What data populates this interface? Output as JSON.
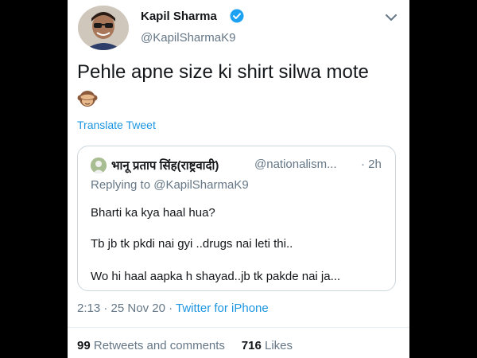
{
  "tweet": {
    "author_name": "Kapil Sharma",
    "author_handle": "@KapilSharmaK9",
    "text": "Pehle apne size ki shirt silwa mote",
    "emoji": "see-no-evil-monkey-icon",
    "translate_label": "Translate Tweet",
    "time": "2:13",
    "date": "25 Nov 20",
    "separator": "·",
    "source": "Twitter for iPhone"
  },
  "quote": {
    "name": "भानू प्रताप सिंह(राष्ट्रवादी)",
    "handle": "@nationalism...",
    "time": "· 2h",
    "replying": "Replying to @KapilSharmaK9",
    "lines": [
      "Bharti ka kya haal hua?",
      "Tb jb tk pkdi nai gyi ..drugs nai leti thi..",
      "Wo hi haal aapka h shayad..jb tk pakde nai ja..."
    ]
  },
  "stats": {
    "retweets_count": "99",
    "retweets_label": "Retweets and comments",
    "likes_count": "716",
    "likes_label": "Likes"
  },
  "colors": {
    "link": "#1b95e0",
    "verified": "#1da1f2",
    "muted": "#657786"
  }
}
